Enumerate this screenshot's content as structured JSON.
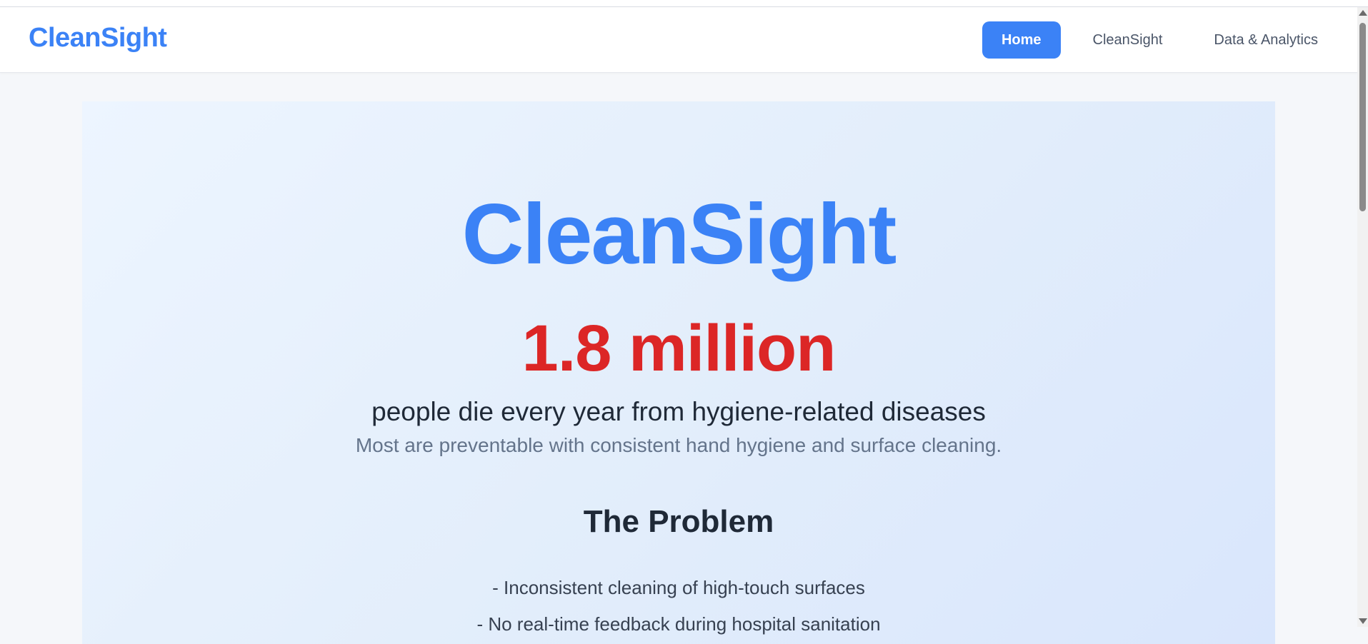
{
  "colors": {
    "brand": "#3b82f6",
    "accent_red": "#dc2626",
    "nav_active_bg": "#3b82f6"
  },
  "nav": {
    "brand": "CleanSight",
    "links": [
      {
        "label": "Home",
        "active": true
      },
      {
        "label": "CleanSight",
        "active": false
      },
      {
        "label": "Data & Analytics",
        "active": false
      }
    ]
  },
  "hero": {
    "title": "CleanSight",
    "stat": "1.8 million",
    "subtitle": "people die every year from hygiene-related diseases",
    "note": "Most are preventable with consistent hand hygiene and surface cleaning."
  },
  "problem": {
    "heading": "The Problem",
    "items": [
      "- Inconsistent cleaning of high-touch surfaces",
      "- No real-time feedback during hospital sanitation"
    ]
  }
}
